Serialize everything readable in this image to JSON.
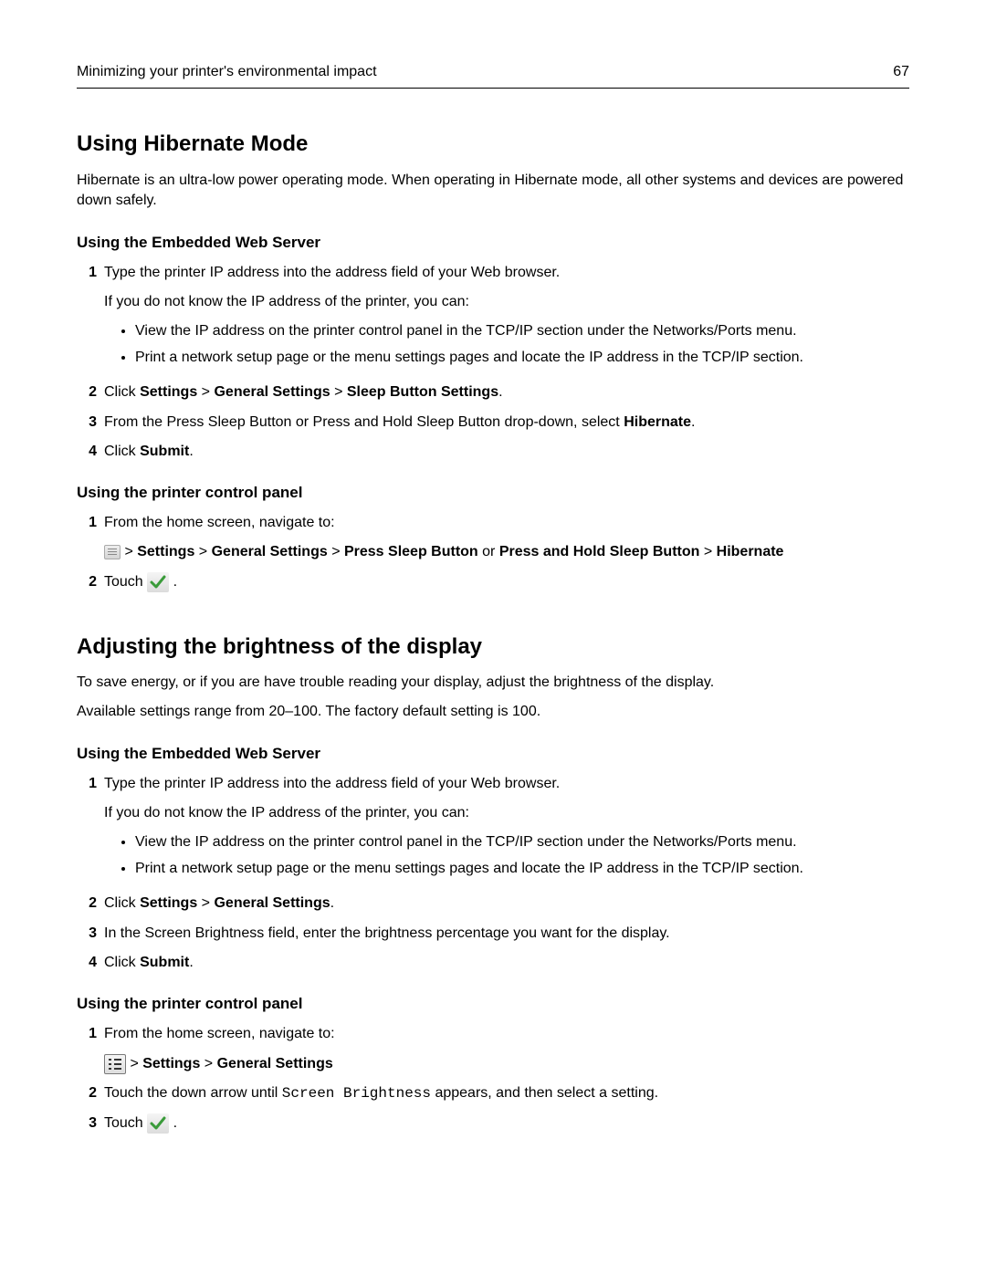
{
  "header": {
    "left": "Minimizing your printer's environmental impact",
    "right": "67"
  },
  "s1": {
    "title": "Using Hibernate Mode",
    "intro": "Hibernate is an ultra-low power operating mode. When operating in Hibernate mode, all other systems and devices are powered down safely.",
    "ews": {
      "title": "Using the Embedded Web Server",
      "n1": "1",
      "n1_text": "Type the printer IP address into the address field of your Web browser.",
      "n1_sub": "If you do not know the IP address of the printer, you can:",
      "n1_b1": "View the IP address on the printer control panel in the TCP/IP section under the Networks/Ports menu.",
      "n1_b2": "Print a network setup page or the menu settings pages and locate the IP address in the TCP/IP section.",
      "n2": "2",
      "n2_a": "Click ",
      "n2_b1": "Settings",
      "n2_c": " > ",
      "n2_b2": "General Settings",
      "n2_d": " > ",
      "n2_b3": "Sleep Button Settings",
      "n2_e": ".",
      "n3": "3",
      "n3_a": "From the Press Sleep Button or Press and Hold Sleep Button drop-down, select ",
      "n3_b": "Hibernate",
      "n3_c": ".",
      "n4": "4",
      "n4_a": "Click ",
      "n4_b": "Submit",
      "n4_c": "."
    },
    "panel": {
      "title": "Using the printer control panel",
      "n1": "1",
      "n1_text": "From the home screen, navigate to:",
      "nav_a": " > ",
      "nav_b1": "Settings",
      "nav_b": " > ",
      "nav_b2": "General Settings",
      "nav_c": " > ",
      "nav_b3": "Press Sleep Button",
      "nav_d": " or ",
      "nav_b4": "Press and Hold Sleep Button",
      "nav_e": " > ",
      "nav_b5": "Hibernate",
      "n2": "2",
      "n2_a": "Touch ",
      "n2_b": " ."
    }
  },
  "s2": {
    "title": "Adjusting the brightness of the display",
    "p1": "To save energy, or if you are have trouble reading your display, adjust the brightness of the display.",
    "p2": "Available settings range from 20–100. The factory default setting is 100.",
    "ews": {
      "title": "Using the Embedded Web Server",
      "n1": "1",
      "n1_text": "Type the printer IP address into the address field of your Web browser.",
      "n1_sub": "If you do not know the IP address of the printer, you can:",
      "n1_b1": "View the IP address on the printer control panel in the TCP/IP section under the Networks/Ports menu.",
      "n1_b2": "Print a network setup page or the menu settings pages and locate the IP address in the TCP/IP section.",
      "n2": "2",
      "n2_a": "Click ",
      "n2_b1": "Settings",
      "n2_c": " > ",
      "n2_b2": "General Settings",
      "n2_d": ".",
      "n3": "3",
      "n3_text": "In the Screen Brightness field, enter the brightness percentage you want for the display.",
      "n4": "4",
      "n4_a": "Click ",
      "n4_b": "Submit",
      "n4_c": "."
    },
    "panel": {
      "title": "Using the printer control panel",
      "n1": "1",
      "n1_text": "From the home screen, navigate to:",
      "nav_a": " > ",
      "nav_b1": "Settings",
      "nav_b": " > ",
      "nav_b2": "General Settings",
      "n2": "2",
      "n2_a": "Touch the down arrow until ",
      "n2_mono": "Screen Brightness",
      "n2_b": " appears, and then select a setting.",
      "n3": "3",
      "n3_a": "Touch ",
      "n3_b": " ."
    }
  }
}
